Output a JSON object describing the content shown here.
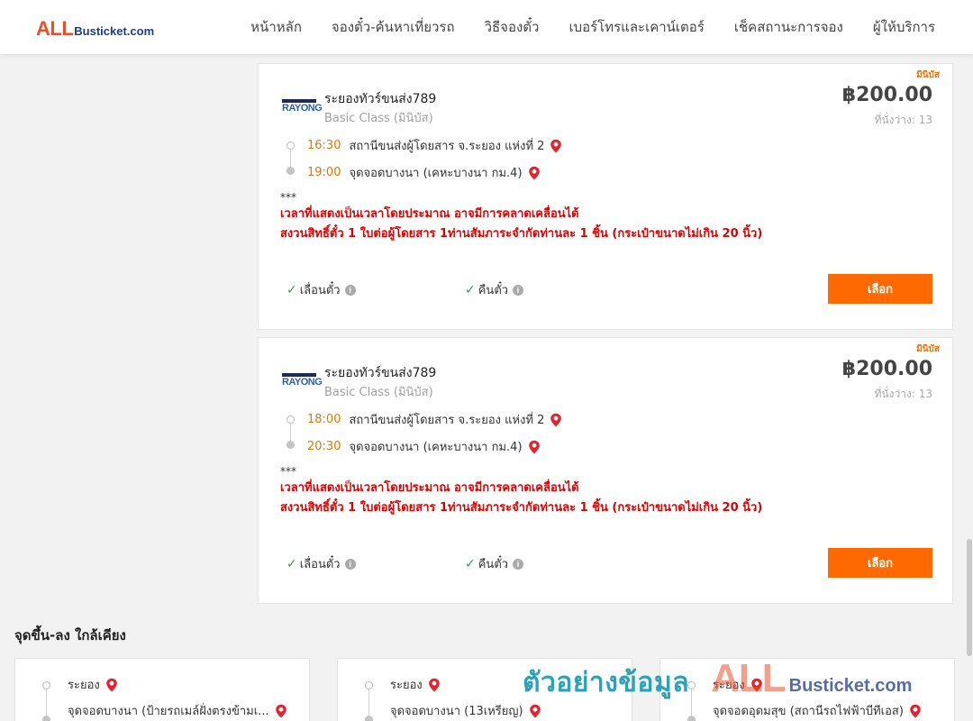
{
  "header": {
    "logo_all": "ALL",
    "logo_rest": "Busticket.com",
    "nav": [
      "หน้าหลัก",
      "จองตั๋ว-ค้นหาเที่ยวรถ",
      "วิธีจองตั๋ว",
      "เบอร์โทรและเคาน์เตอร์",
      "เช็คสถานะการจอง",
      "ผู้ให้บริการ"
    ]
  },
  "trips": [
    {
      "badge": "มินิบัส",
      "operator_logo": "RAYONG",
      "operator": "ระยองทัวร์ขนส่ง789",
      "class": "Basic Class (มินิบัส)",
      "price": "฿200.00",
      "seats": "ที่นั่งว่าง: 13",
      "depart_time": "16:30",
      "depart_station": "สถานีขนส่งผู้โดยสาร จ.ระยอง แห่งที่ 2",
      "arrive_time": "19:00",
      "arrive_station": "จุดจอดบางนา (เคหะบางนา กม.4)",
      "note_stars": "***",
      "note_line1": "เวลาที่แสดงเป็นเวลาโดยประมาณ อาจมีการคลาดเคลื่อนได้",
      "note_line2": "สงวนสิทธิ์ตั๋ว 1 ใบต่อผู้โดยสาร 1ท่านสัมภาระจำกัดท่านละ 1 ชิ้น (กระเป๋าขนาดไม่เกิน 20 นิ้ว)",
      "feature1": "เลื่อนตั๋ว",
      "feature2": "คืนตั๋ว",
      "button": "เลือก"
    },
    {
      "badge": "มินิบัส",
      "operator_logo": "RAYONG",
      "operator": "ระยองทัวร์ขนส่ง789",
      "class": "Basic Class (มินิบัส)",
      "price": "฿200.00",
      "seats": "ที่นั่งว่าง: 13",
      "depart_time": "18:00",
      "depart_station": "สถานีขนส่งผู้โดยสาร จ.ระยอง แห่งที่ 2",
      "arrive_time": "20:30",
      "arrive_station": "จุดจอดบางนา (เคหะบางนา กม.4)",
      "note_stars": "***",
      "note_line1": "เวลาที่แสดงเป็นเวลาโดยประมาณ อาจมีการคลาดเคลื่อนได้",
      "note_line2": "สงวนสิทธิ์ตั๋ว 1 ใบต่อผู้โดยสาร 1ท่านสัมภาระจำกัดท่านละ 1 ชิ้น (กระเป๋าขนาดไม่เกิน 20 นิ้ว)",
      "feature1": "เลื่อนตั๋ว",
      "feature2": "คืนตั๋ว",
      "button": "เลือก"
    }
  ],
  "nearby": {
    "title": "จุดขึ้น-ลง ใกล้เคียง",
    "items": [
      {
        "from": "ระยอง",
        "to": "จุดจอดบางนา (ป้ายรถเมล์ฝั่งตรงข้ามเ..."
      },
      {
        "from": "ระยอง",
        "to": "จุดจอดบางนา (13เหรียญ)"
      },
      {
        "from": "ระยอง",
        "to": "จุดจอดอุดมสุข (สถานีรถไฟฟ้าบีทีเอส)"
      }
    ]
  },
  "watermark": {
    "text": "ตัวอย่างข้อมูล",
    "all": "ALL",
    "rest": "Busticket.com"
  },
  "colors": {
    "accent": "#ff6a00",
    "time": "#e07800",
    "warning": "#e00000",
    "pin": "#e8212e",
    "check": "#2f9e44"
  }
}
